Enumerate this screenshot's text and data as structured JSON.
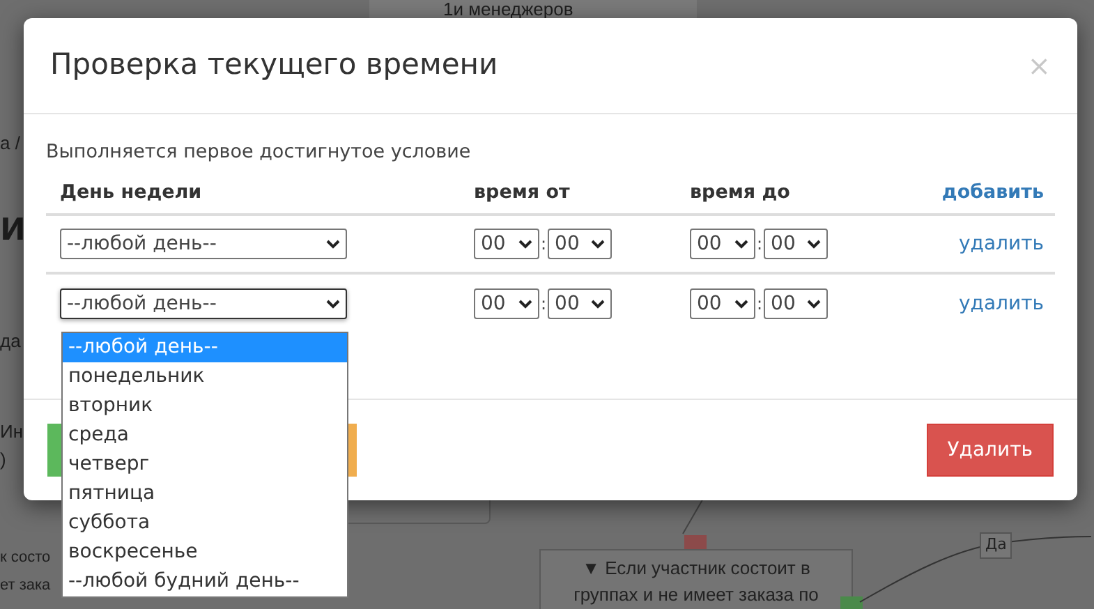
{
  "background": {
    "texts": [
      {
        "kind": "top",
        "text": "1и менеджеров"
      },
      {
        "kind": "crumb",
        "text": "а /"
      },
      {
        "kind": "heading",
        "text": "и"
      },
      {
        "kind": "link",
        "text": "да"
      },
      {
        "kind": "card",
        "text": "Ин"
      },
      {
        "kind": "card2",
        "text": ")"
      },
      {
        "kind": "left1",
        "text": "к состо"
      },
      {
        "kind": "left2",
        "text": "ет зака"
      }
    ],
    "node": {
      "icon": "▼",
      "text": "Если участник состоит в группах и не имеет заказа по"
    },
    "edge_label": "Да"
  },
  "modal": {
    "title": "Проверка текущего времени",
    "close": "×",
    "subtitle": "Выполняется первое достигнутое условие",
    "columns": [
      "День недели",
      "время от",
      "время до"
    ],
    "add_link": "добавить",
    "rows": [
      {
        "day": "--любой день--",
        "from_hour": "00",
        "from_min": "00",
        "to_hour": "00",
        "to_min": "00",
        "delete": "удалить",
        "open": false
      },
      {
        "day": "--любой день--",
        "from_hour": "00",
        "from_min": "00",
        "to_hour": "00",
        "to_min": "00",
        "delete": "удалить",
        "open": true
      }
    ],
    "time_separator": ":",
    "footer_buttons": [
      {
        "kind": "success"
      },
      {
        "kind": "warning"
      }
    ],
    "delete_button": "Удалить"
  },
  "dropdown": {
    "options": [
      {
        "label": "--любой день--",
        "selected": true
      },
      {
        "label": "понедельник",
        "selected": false
      },
      {
        "label": "вторник",
        "selected": false
      },
      {
        "label": "среда",
        "selected": false
      },
      {
        "label": "четверг",
        "selected": false
      },
      {
        "label": "пятница",
        "selected": false
      },
      {
        "label": "суббота",
        "selected": false
      },
      {
        "label": "воскресенье",
        "selected": false
      },
      {
        "label": "--любой будний день--",
        "selected": false
      }
    ]
  }
}
